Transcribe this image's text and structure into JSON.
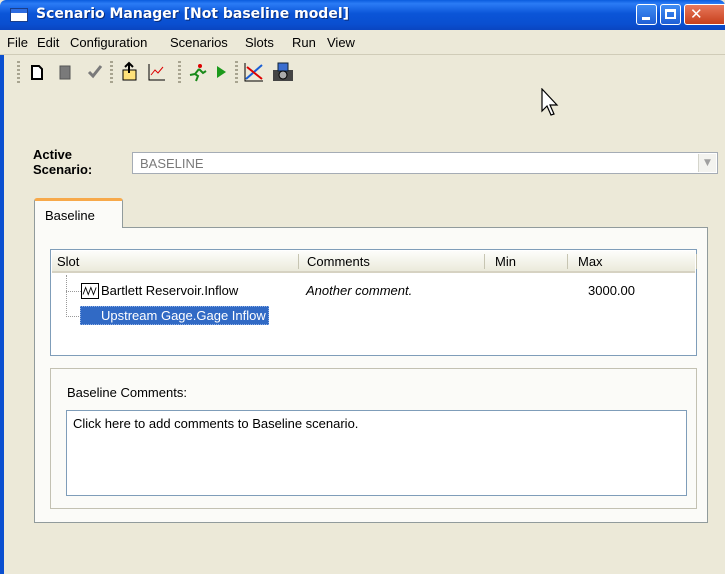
{
  "window": {
    "title": "Scenario Manager [Not baseline model]"
  },
  "menu": [
    "File",
    "Edit",
    "Configuration",
    "Scenarios",
    "Slots",
    "Run",
    "View"
  ],
  "toolbar": {
    "icons": [
      "new-icon",
      "delete-icon",
      "check-icon",
      "export-icon",
      "chart-icon",
      "run-figure-icon",
      "play-icon",
      "compare-chart-icon",
      "snapshot-icon"
    ]
  },
  "active_scenario": {
    "label_line1": "Active",
    "label_line2": "Scenario:",
    "value": "BASELINE"
  },
  "tabs": [
    {
      "label": "Baseline"
    }
  ],
  "table": {
    "columns": [
      "Slot",
      "Comments",
      "Min",
      "Max"
    ],
    "rows": [
      {
        "slot": "Bartlett Reservoir.Inflow",
        "comments": "Another comment.",
        "min": "",
        "max": "3000.00",
        "icon": "series-slot-icon"
      },
      {
        "slot": "Upstream Gage.Gage Inflow",
        "comments": "",
        "min": "",
        "max": "",
        "icon": "series-slot-icon",
        "selected": true
      }
    ]
  },
  "baseline_comments": {
    "label": "Baseline Comments:",
    "text": "Click here to add comments to Baseline scenario."
  },
  "colors": {
    "title_bar": "#0a55d8",
    "selection": "#316ac5",
    "tab_accent": "#f7a94a"
  }
}
